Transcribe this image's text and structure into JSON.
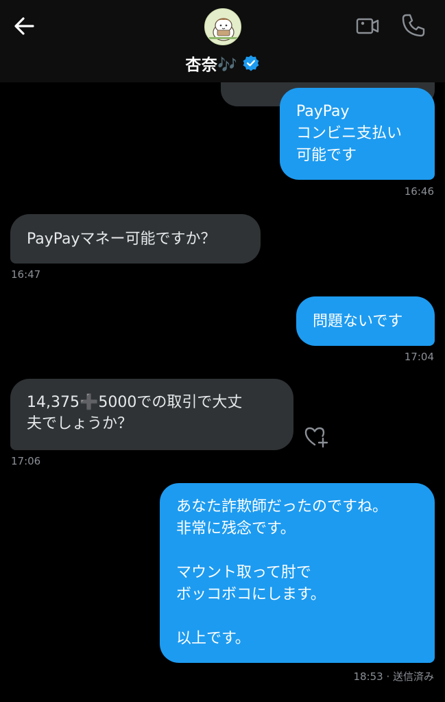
{
  "header": {
    "title": "杏奈🎶",
    "avatar_icon": "character-avatar-icon",
    "verified_icon": "verified-badge-icon",
    "accent": "#1d9bf0"
  },
  "messages": [
    {
      "direction": "sent",
      "text": "PayPay\nコンビニ支払い\n可能です",
      "time": "16:46"
    },
    {
      "direction": "received",
      "text": "PayPayマネー可能ですか？",
      "time": "16:47"
    },
    {
      "direction": "sent",
      "text": "問題ないです",
      "time": "17:04"
    },
    {
      "direction": "received",
      "text": "14,375➕5000での取引で大丈\n夫でしょうか？",
      "time": "17:06"
    },
    {
      "direction": "sent",
      "text": "あなた詐欺師だったのですね。\n非常に残念です。\n\nマウント取って肘で\nボッコボコにします。\n\n以上です。",
      "time": "18:53 · 送信済み"
    }
  ],
  "colors": {
    "sent_bubble": "#1d9bf0",
    "received_bubble": "#2f3336",
    "background": "#000000",
    "timestamp": "#8b9096"
  }
}
